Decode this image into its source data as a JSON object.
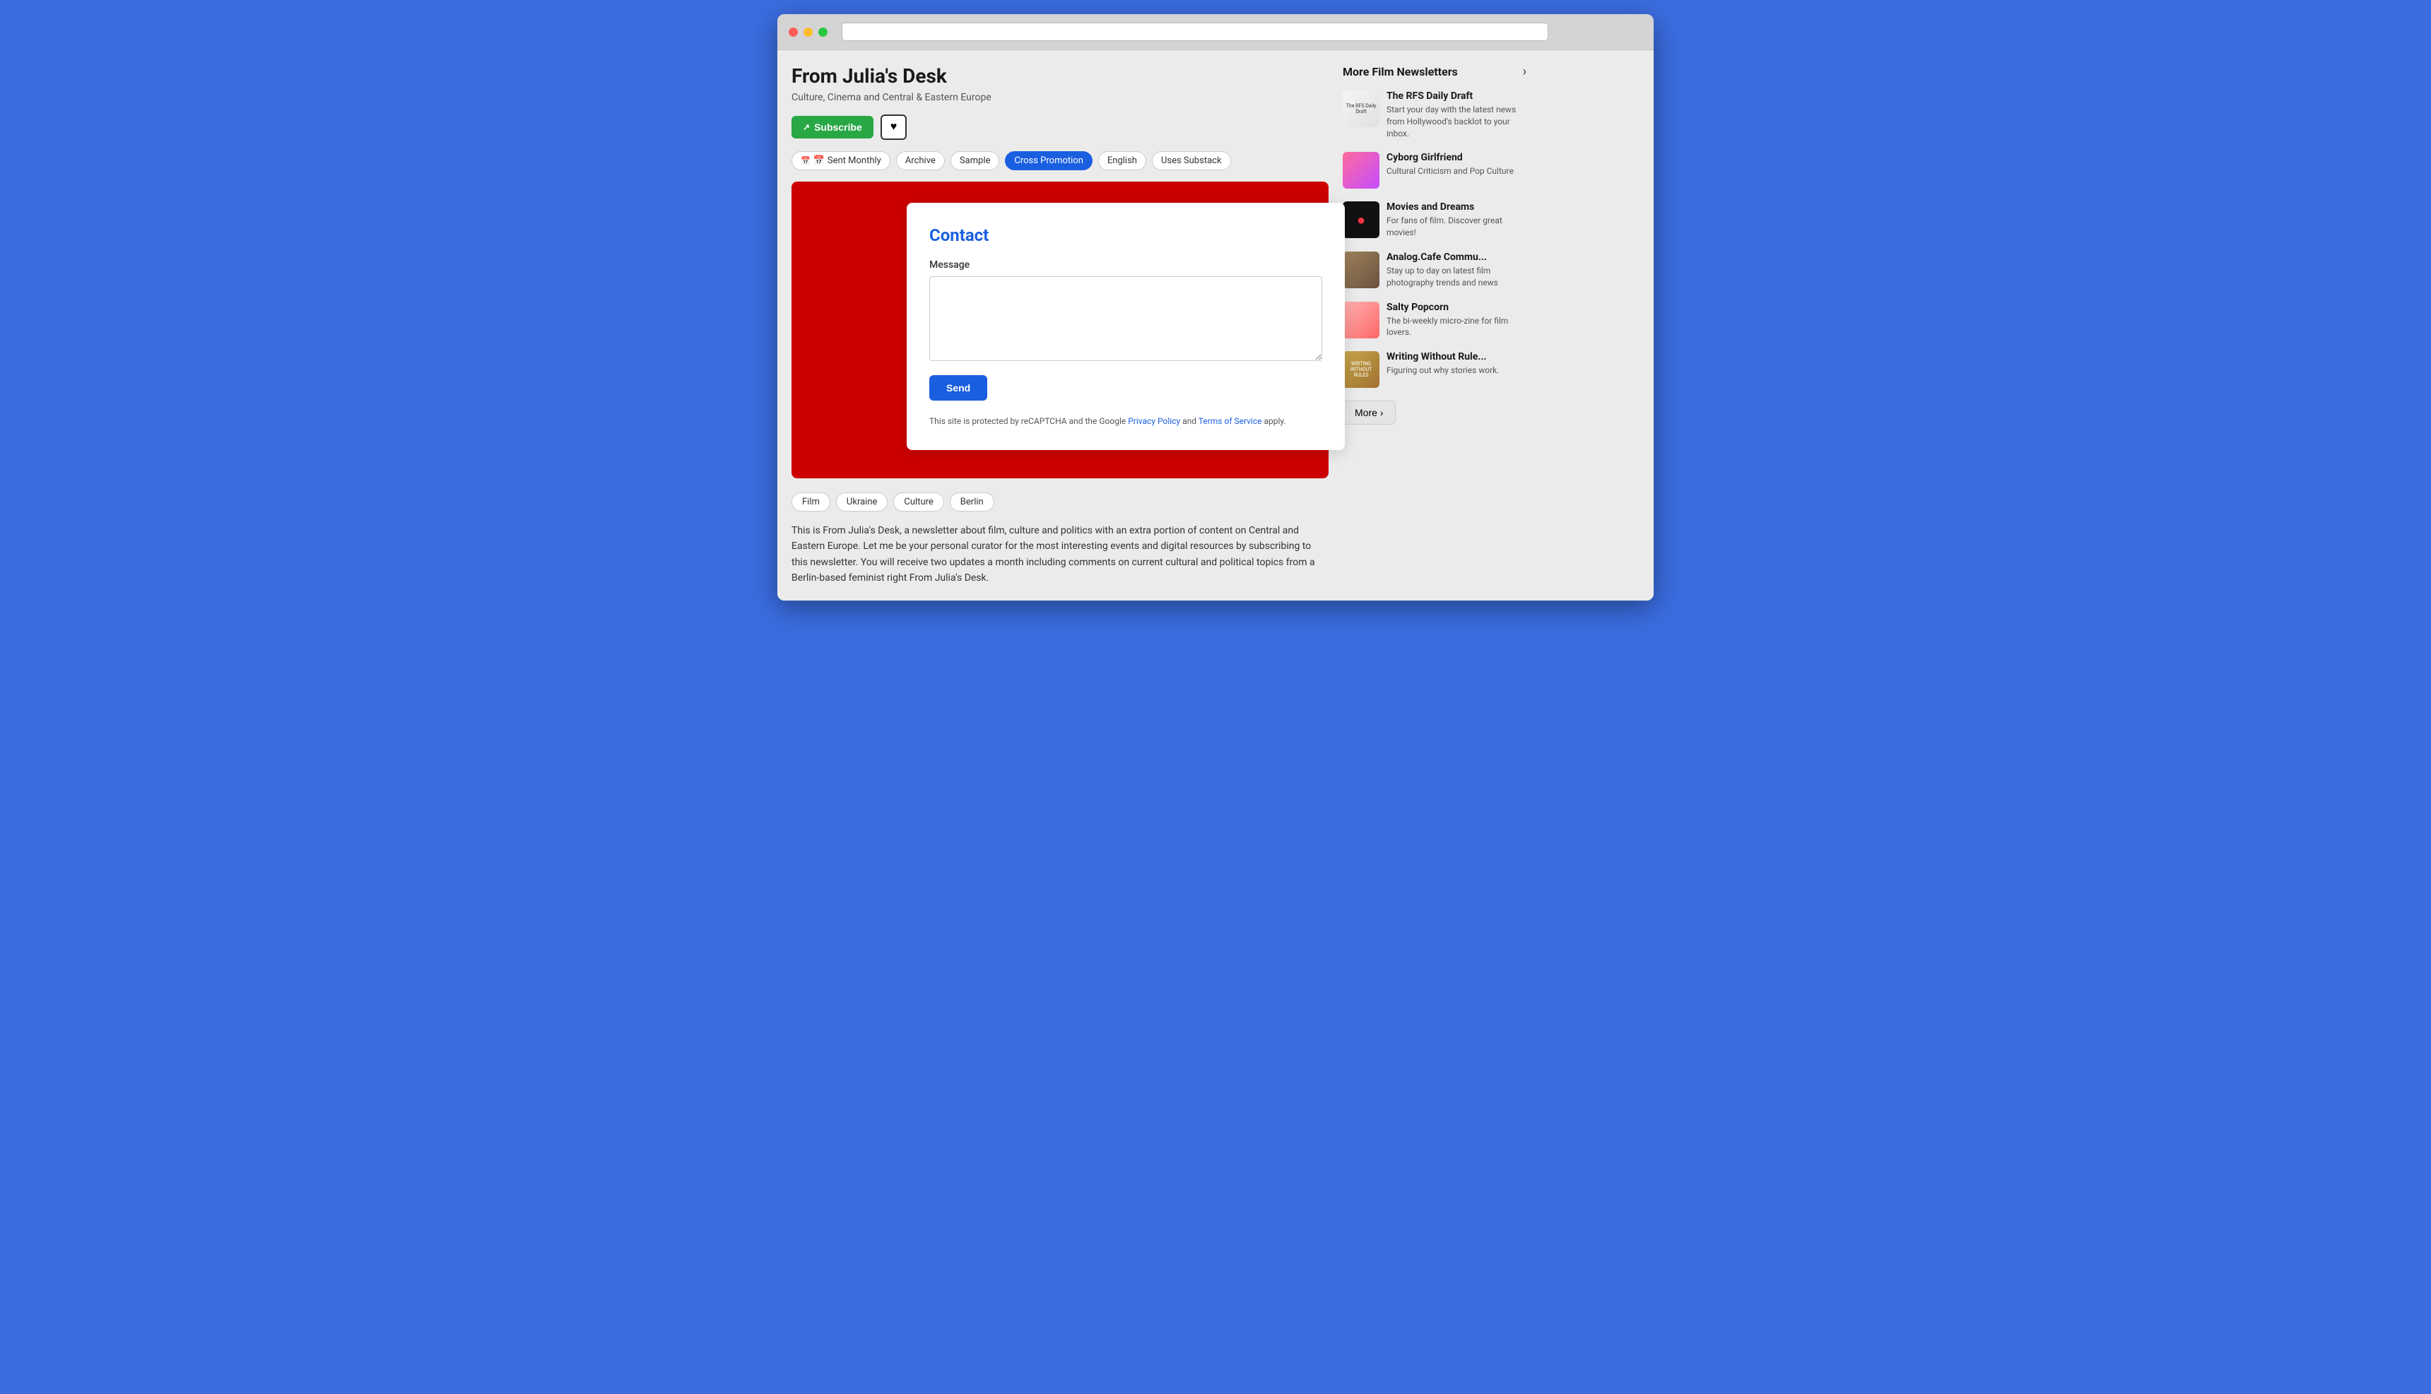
{
  "browser": {
    "title": "From Julia's Desk",
    "url": ""
  },
  "header": {
    "title": "From Julia's Desk",
    "subtitle": "Culture, Cinema and Central & Eastern Europe",
    "subscribe_label": "Subscribe",
    "heart_label": "♥"
  },
  "tags": [
    {
      "id": "sent-monthly",
      "label": "Sent Monthly",
      "icon": "calendar",
      "active": false
    },
    {
      "id": "archive",
      "label": "Archive",
      "active": false
    },
    {
      "id": "sample",
      "label": "Sample",
      "active": false
    },
    {
      "id": "cross-promotion",
      "label": "Cross Promotion",
      "active": true
    },
    {
      "id": "english",
      "label": "English",
      "active": false
    },
    {
      "id": "uses-substack",
      "label": "Uses Substack",
      "active": false
    }
  ],
  "contact": {
    "title": "Contact",
    "message_label": "Message",
    "message_placeholder": "",
    "send_label": "Send",
    "recaptcha_text": "This site is protected by reCAPTCHA and the Google",
    "privacy_policy_label": "Privacy Policy",
    "and_text": "and",
    "terms_label": "Terms of Service",
    "apply_text": "apply."
  },
  "category_tags": [
    "Film",
    "Ukraine",
    "Culture",
    "Berlin"
  ],
  "description": "This is From Julia's Desk, a newsletter about film, culture and politics with an extra portion of content on Central and Eastern Europe. Let me be your personal curator for the most interesting events and digital resources by subscribing to this newsletter. You will receive two updates a month including comments on current cultural and political topics from a Berlin-based feminist right From Julia's Desk.",
  "sidebar": {
    "title": "More Film Newsletters",
    "more_label": "More",
    "newsletters": [
      {
        "id": "rfs-daily-draft",
        "name": "The RFS Daily Draft",
        "description": "Start your day with the latest news from Hollywood's backlot to your inbox.",
        "thumb_type": "rfs"
      },
      {
        "id": "cyborg-girlfriend",
        "name": "Cyborg Girlfriend",
        "description": "Cultural Criticism and Pop Culture",
        "thumb_type": "cyborg"
      },
      {
        "id": "movies-and-dreams",
        "name": "Movies and Dreams",
        "description": "For fans of film. Discover great movies!",
        "thumb_type": "movies"
      },
      {
        "id": "analog-cafe",
        "name": "Analog.Cafe Commu...",
        "description": "Stay up to day on latest film photography trends and news",
        "thumb_type": "analog"
      },
      {
        "id": "salty-popcorn",
        "name": "Salty Popcorn",
        "description": "The bi-weekly micro-zine for film lovers.",
        "thumb_type": "salty"
      },
      {
        "id": "writing-without-rules",
        "name": "Writing Without Rule...",
        "description": "Figuring out why stories work.",
        "thumb_type": "writing"
      }
    ]
  }
}
